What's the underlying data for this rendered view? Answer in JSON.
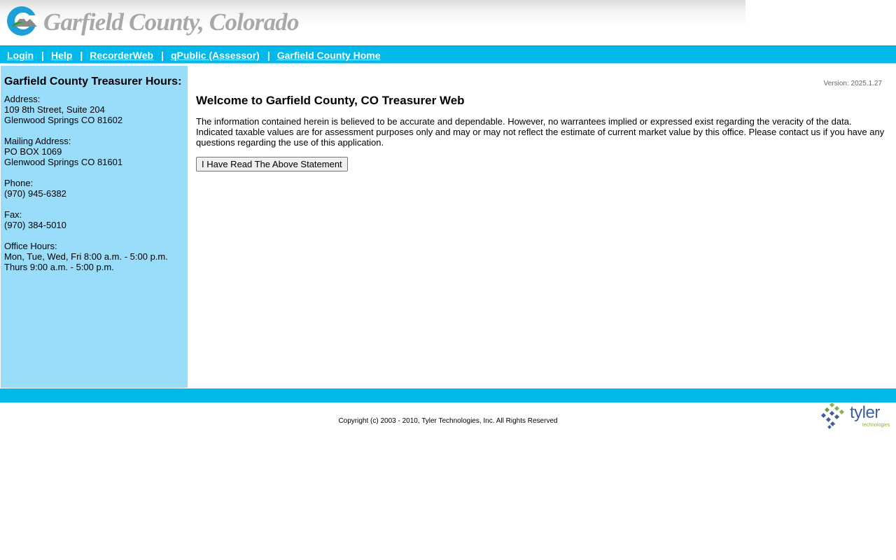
{
  "header": {
    "title": "Garfield County, Colorado",
    "logo_icon": "county-c-mountain-logo"
  },
  "nav": {
    "items": [
      {
        "label": "Login"
      },
      {
        "label": "Help"
      },
      {
        "label": "RecorderWeb"
      },
      {
        "label": "qPublic (Assessor)"
      },
      {
        "label": "Garfield County Home"
      }
    ],
    "separator": "|"
  },
  "sidebar": {
    "heading": "Garfield County Treasurer Hours:",
    "address": {
      "label": "Address:",
      "line1": "109 8th Street, Suite 204",
      "line2": "Glenwood Springs CO 81602"
    },
    "mailing": {
      "label": "Mailing Address:",
      "line1": "PO BOX 1069",
      "line2": "Glenwood Springs CO 81601"
    },
    "phone": {
      "label": "Phone:",
      "value": "(970) 945-6382"
    },
    "fax": {
      "label": "Fax:",
      "value": "(970) 384-5010"
    },
    "hours": {
      "label": "Office Hours:",
      "line1": "Mon, Tue, Wed, Fri 8:00 a.m. - 5:00 p.m.",
      "line2": "Thurs 9:00 a.m. - 5:00 p.m."
    }
  },
  "main": {
    "version": "Version: 2025.1.27",
    "title": "Welcome to Garfield County, CO Treasurer Web",
    "disclaimer": "The information contained herein is believed to be accurate and dependable. However, no warrantees implied or expressed exist regarding the veracity of the data. Indicated taxable values are for assessment purposes only and may or may not reflect the estimate of current market value by this office. Please contact us if you have any questions regarding the use of this application.",
    "ack_button": "I Have Read The Above Statement"
  },
  "footer": {
    "copyright": "Copyright (c) 2003 - 2010, Tyler Technologies, Inc. All Rights Reserved",
    "tyler_word": "tyler",
    "tyler_sub": "technologies"
  },
  "colors": {
    "bar_blue": "#00b8ea",
    "sidebar_blue": "#99ddfb",
    "title_gray": "#a8a8a8",
    "tyler_blue": "#3f5f9c",
    "tyler_green": "#8cb33f"
  }
}
